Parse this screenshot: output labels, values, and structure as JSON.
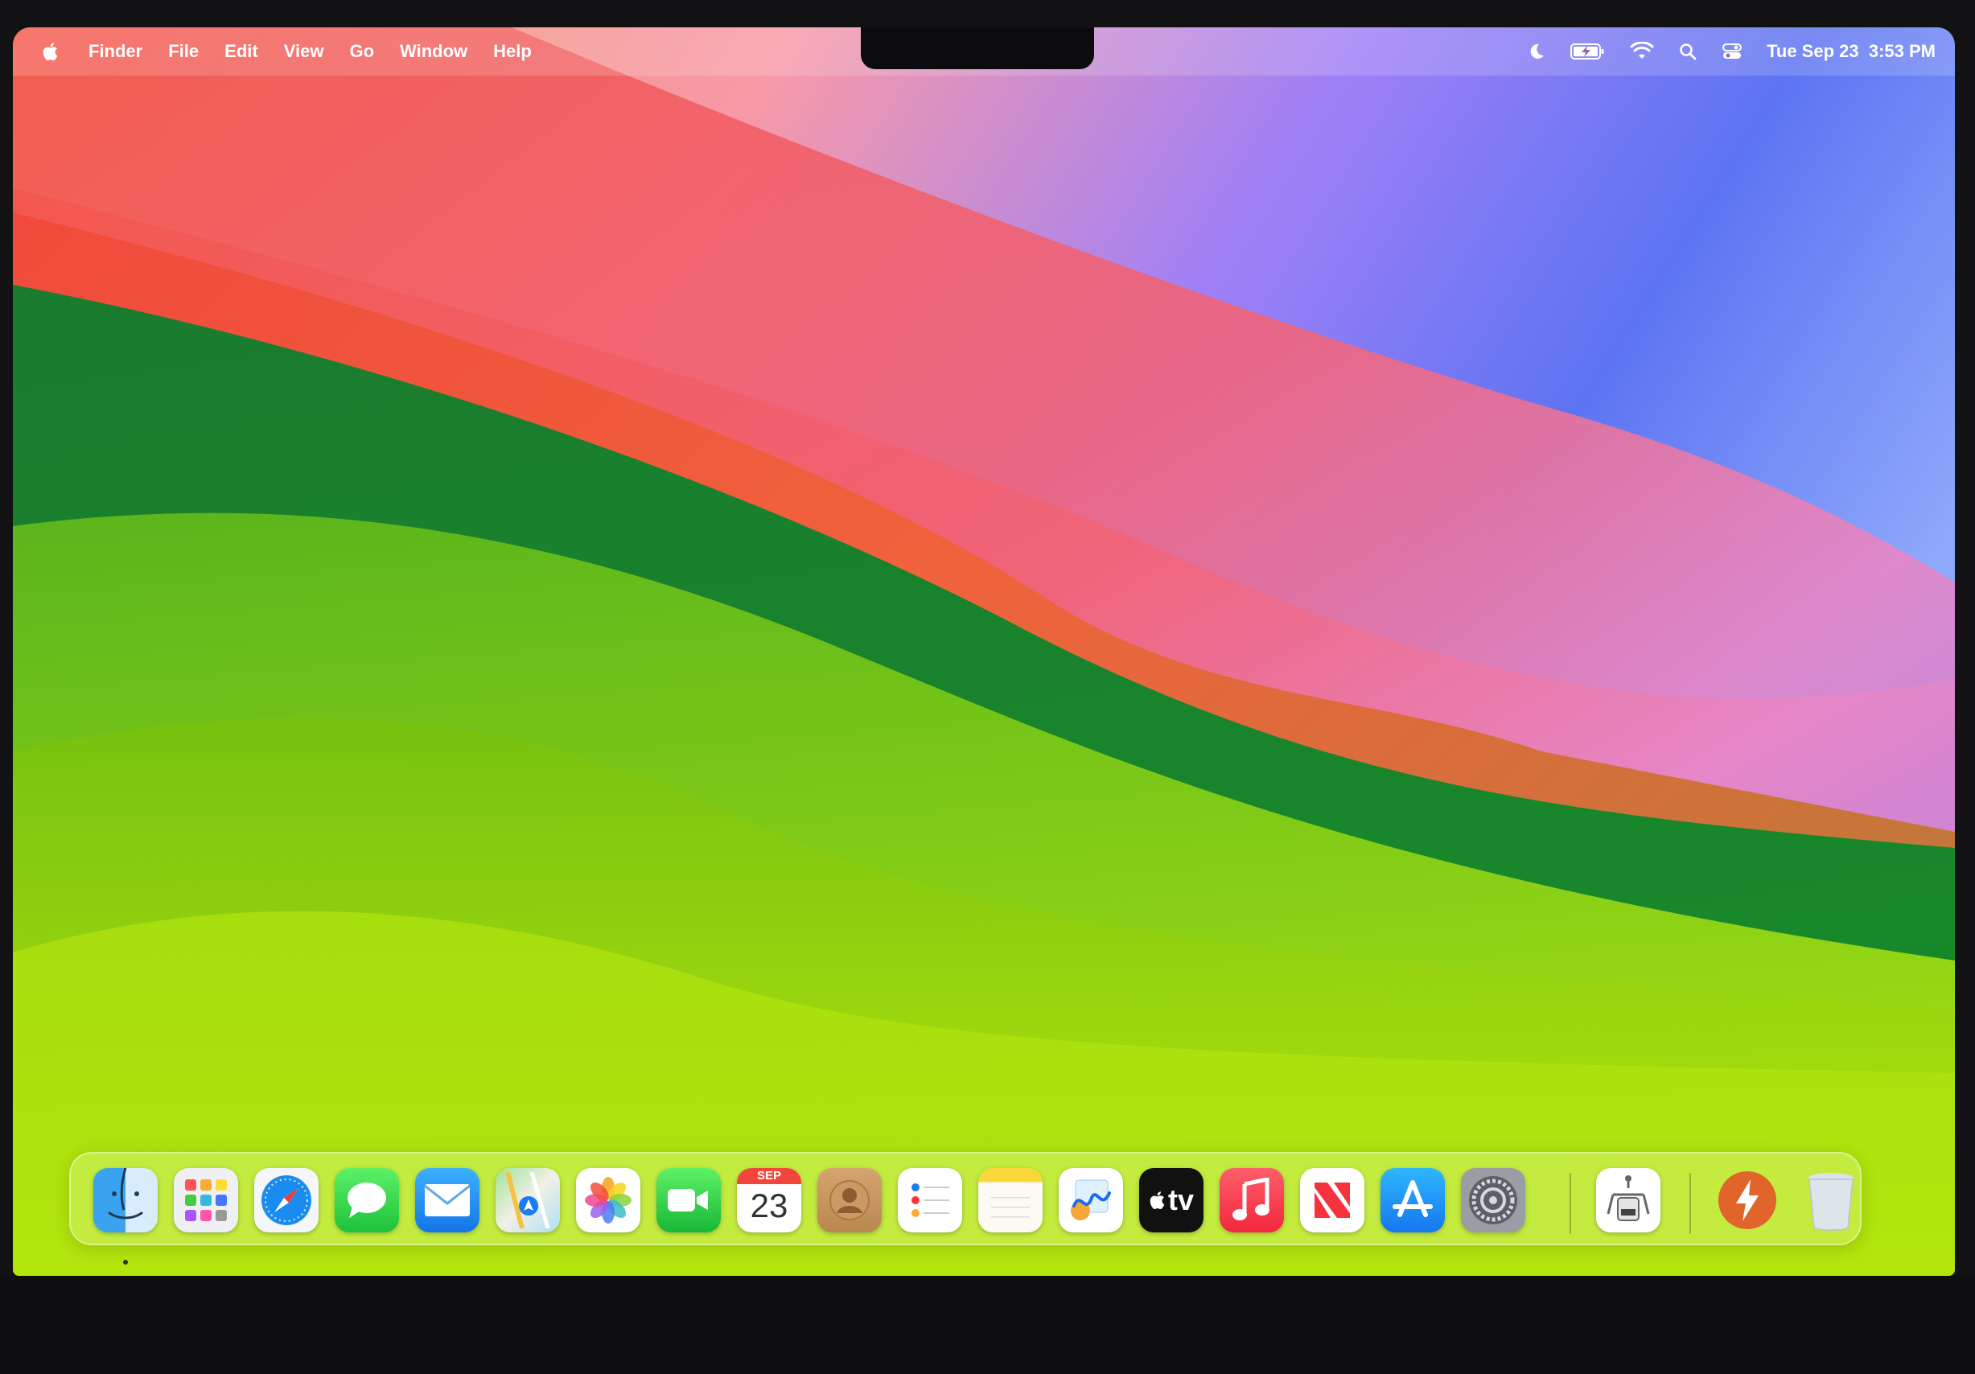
{
  "menubar": {
    "app_name": "Finder",
    "menus": [
      "File",
      "Edit",
      "View",
      "Go",
      "Window",
      "Help"
    ],
    "clock": "Tue Sep 23  3:53 PM"
  },
  "status_icons": [
    "focus-moon-icon",
    "battery-charging-icon",
    "wifi-icon",
    "spotlight-search-icon",
    "control-center-icon"
  ],
  "dock": {
    "apps": [
      "Finder",
      "Launchpad",
      "Safari",
      "Messages",
      "Mail",
      "Maps",
      "Photos",
      "FaceTime",
      "Calendar",
      "Contacts",
      "Reminders",
      "Notes",
      "Freeform",
      "TV",
      "Music",
      "News",
      "App Store",
      "System Settings",
      "Automator",
      "Reeder",
      "Trash"
    ],
    "calendar": {
      "month": "SEP",
      "day": "23"
    },
    "tv_label": "tv"
  }
}
